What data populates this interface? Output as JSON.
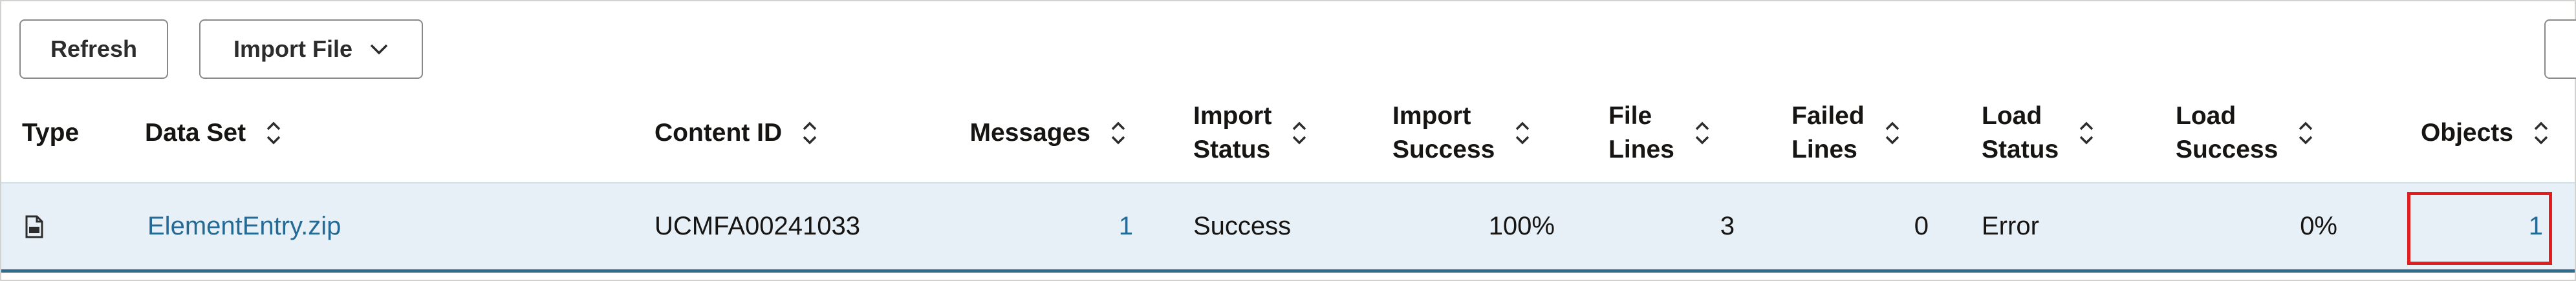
{
  "toolbar": {
    "refresh_label": "Refresh",
    "import_label": "Import File"
  },
  "table": {
    "columns": [
      {
        "key": "type",
        "line1": "Type",
        "line2": "",
        "sortable": false
      },
      {
        "key": "data_set",
        "line1": "Data Set",
        "line2": "",
        "sortable": true
      },
      {
        "key": "content_id",
        "line1": "Content ID",
        "line2": "",
        "sortable": true
      },
      {
        "key": "messages",
        "line1": "Messages",
        "line2": "",
        "sortable": true
      },
      {
        "key": "import_status",
        "line1": "Import",
        "line2": "Status",
        "sortable": true
      },
      {
        "key": "import_success",
        "line1": "Import",
        "line2": "Success",
        "sortable": true
      },
      {
        "key": "file_lines",
        "line1": "File",
        "line2": "Lines",
        "sortable": true
      },
      {
        "key": "failed_lines",
        "line1": "Failed",
        "line2": "Lines",
        "sortable": true
      },
      {
        "key": "load_status",
        "line1": "Load",
        "line2": "Status",
        "sortable": true
      },
      {
        "key": "load_success",
        "line1": "Load",
        "line2": "Success",
        "sortable": true
      },
      {
        "key": "objects",
        "line1": "Objects",
        "line2": "",
        "sortable": true
      }
    ],
    "rows": [
      {
        "type_icon": "zip-file-icon",
        "data_set": "ElementEntry.zip",
        "content_id": "UCMFA00241033",
        "messages": "1",
        "import_status": "Success",
        "import_success": "100%",
        "file_lines": "3",
        "failed_lines": "0",
        "load_status": "Error",
        "load_success": "0%",
        "objects": "1"
      }
    ]
  },
  "colors": {
    "link": "#256a95",
    "row_background": "#e6f0f6",
    "row_border": "#2c6b8e",
    "highlight": "#e01e1e"
  }
}
